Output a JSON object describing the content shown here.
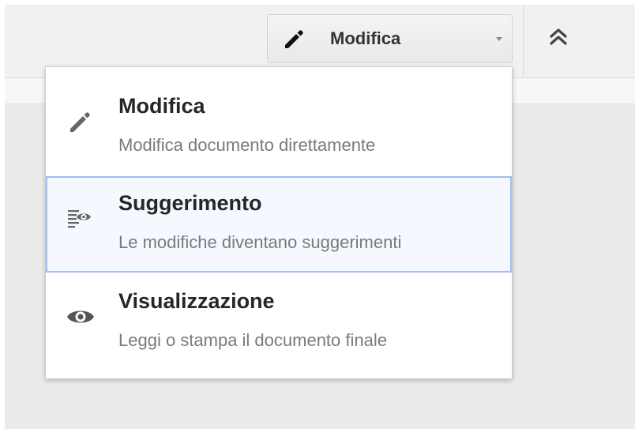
{
  "toolbar": {
    "mode_button": {
      "label": "Modifica",
      "icon": "pencil-icon"
    },
    "collapse_icon": "double-chevron-up-icon"
  },
  "mode_menu": {
    "items": [
      {
        "title": "Modifica",
        "description": "Modifica documento direttamente",
        "icon": "pencil-icon",
        "highlighted": false
      },
      {
        "title": "Suggerimento",
        "description": "Le modifiche diventano suggerimenti",
        "icon": "suggestion-icon",
        "highlighted": true
      },
      {
        "title": "Visualizzazione",
        "description": "Leggi o stampa il documento finale",
        "icon": "eye-icon",
        "highlighted": false
      }
    ]
  },
  "colors": {
    "highlight_border": "#a4bdf2",
    "icon_gray": "#666666",
    "title_text": "#262626",
    "description_text": "#7a7a7a"
  }
}
